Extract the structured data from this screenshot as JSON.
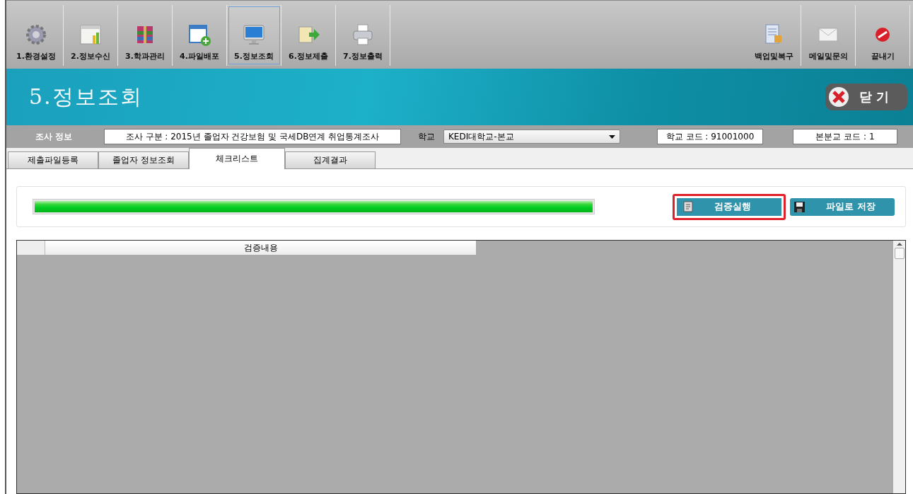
{
  "toolbar": {
    "items": [
      {
        "label": "1.환경설정",
        "selected": false
      },
      {
        "label": "2.정보수신",
        "selected": false
      },
      {
        "label": "3.학과관리",
        "selected": false
      },
      {
        "label": "4.파일배포",
        "selected": false
      },
      {
        "label": "5.정보조회",
        "selected": true
      },
      {
        "label": "6.정보제출",
        "selected": false
      },
      {
        "label": "7.정보출력",
        "selected": false
      }
    ],
    "right_items": [
      {
        "label": "백업및복구"
      },
      {
        "label": "메일및문의"
      },
      {
        "label": "끝내기"
      }
    ]
  },
  "header": {
    "title": "5.정보조회",
    "close_button": "닫 기"
  },
  "info_bar": {
    "label": "조사 정보",
    "survey": "조사 구분 : 2015년 졸업자 건강보험 및 국세DB연계 취업통계조사",
    "school_label": "학교",
    "school": "KEDI대학교-본교",
    "school_code": "학교 코드 : 91001000",
    "campus_code": "본분교 코드 : 1"
  },
  "tabs": [
    {
      "label": "제출파일등록",
      "selected": false
    },
    {
      "label": "졸업자 정보조회",
      "selected": false
    },
    {
      "label": "체크리스트",
      "selected": true
    },
    {
      "label": "집계결과",
      "selected": false
    }
  ],
  "progress": {
    "level": 1
  },
  "buttons": [
    {
      "label": "검증실행",
      "highlighted": true
    },
    {
      "label": "파일로 저장",
      "highlighted": false
    }
  ],
  "grid": {
    "columns": [
      "검증내용"
    ]
  }
}
